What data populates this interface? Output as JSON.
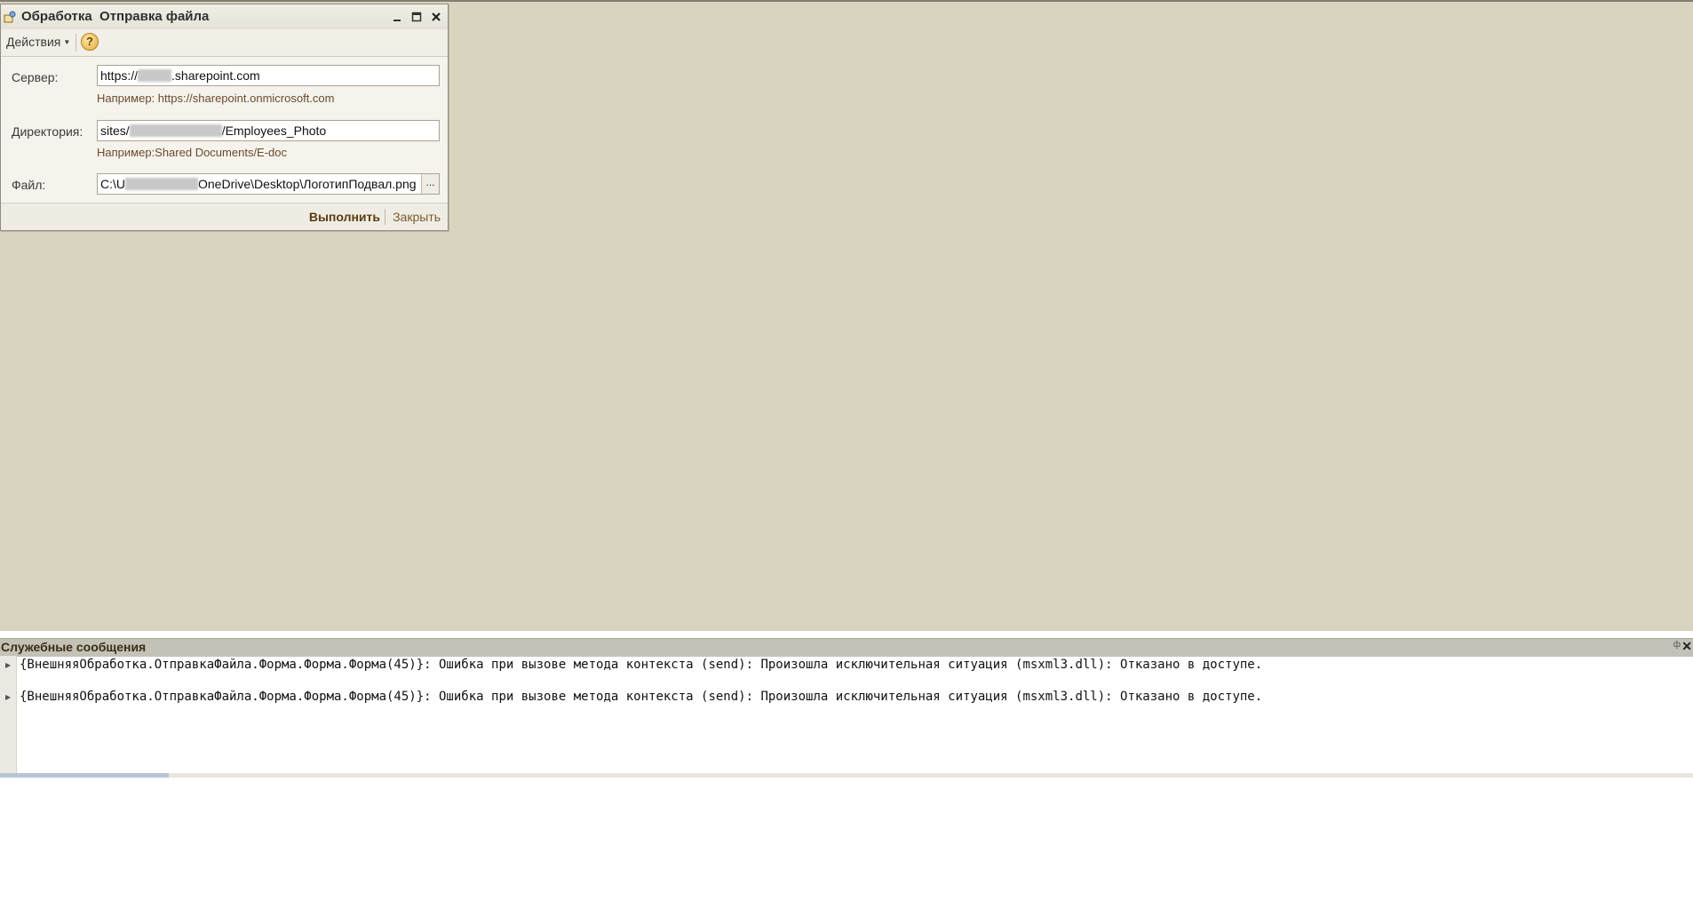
{
  "window": {
    "title": "Обработка  Отправка файла",
    "minimize_icon": "minimize-icon",
    "maximize_icon": "maximize-icon",
    "close_icon": "close-icon"
  },
  "toolbar": {
    "actions_label": "Действия",
    "help_label": "?"
  },
  "form": {
    "server": {
      "label": "Сервер:",
      "value_prefix": "https://",
      "value_suffix": ".sharepoint.com",
      "hint": "Например: https://sharepoint.onmicrosoft.com"
    },
    "directory": {
      "label": "Директория:",
      "value_prefix": "sites/",
      "value_suffix": "/Employees_Photo",
      "hint": "Например:Shared Documents/E-doc"
    },
    "file": {
      "label": "Файл:",
      "value_prefix": "C:\\U",
      "value_suffix": "OneDrive\\Desktop\\ЛоготипПодвал.png",
      "browse_label": "..."
    }
  },
  "footer": {
    "run_label": "Выполнить",
    "close_label": "Закрыть"
  },
  "messages": {
    "title": "Служебные сообщения",
    "items": [
      "{ВнешняяОбработка.ОтправкаФайла.Форма.Форма.Форма(45)}: Ошибка при вызове метода контекста (send): Произошла исключительная ситуация (msxml3.dll): Отказано в доступе.",
      "{ВнешняяОбработка.ОтправкаФайла.Форма.Форма.Форма(45)}: Ошибка при вызове метода контекста (send): Произошла исключительная ситуация (msxml3.dll): Отказано в доступе."
    ]
  },
  "colors": {
    "workspace": "#d8d4bf",
    "accent": "#5a3c12"
  }
}
